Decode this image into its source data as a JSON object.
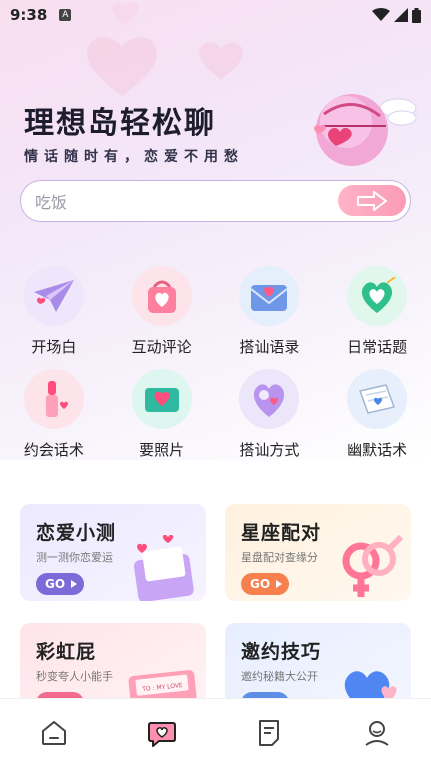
{
  "status_bar": {
    "time": "9:38",
    "badge": "A"
  },
  "header": {
    "title": "理想岛轻松聊",
    "subtitle": "情话随时有，恋爱不用愁"
  },
  "search": {
    "placeholder": "吃饭"
  },
  "categories": [
    {
      "label": "开场白",
      "icon": "paper-plane-icon",
      "bg": "#efe6fb"
    },
    {
      "label": "互动评论",
      "icon": "gift-bag-icon",
      "bg": "#fde4ea"
    },
    {
      "label": "搭讪语录",
      "icon": "envelope-icon",
      "bg": "#e4effb"
    },
    {
      "label": "日常话题",
      "icon": "heart-badge-icon",
      "bg": "#e1f7ee"
    },
    {
      "label": "约会话术",
      "icon": "lipstick-icon",
      "bg": "#fde4ea"
    },
    {
      "label": "要照片",
      "icon": "heart-letter-icon",
      "bg": "#def6f0"
    },
    {
      "label": "搭讪方式",
      "icon": "heart-balloon-icon",
      "bg": "#ece6fb"
    },
    {
      "label": "幽默话术",
      "icon": "scroll-icon",
      "bg": "#e6effb"
    }
  ],
  "cards": [
    {
      "title": "恋爱小测",
      "subtitle": "测一测你恋爱运",
      "go": "GO",
      "accent": "#7b6ad8"
    },
    {
      "title": "星座配对",
      "subtitle": "星盘配对查缘分",
      "go": "GO",
      "accent": "#f6804e"
    },
    {
      "title": "彩虹屁",
      "subtitle": "秒变夸人小能手",
      "go": "GO",
      "accent": "#f46b8e"
    },
    {
      "title": "邀约技巧",
      "subtitle": "邀约秘籍大公开",
      "go": "GO",
      "accent": "#5e8fe6"
    }
  ],
  "card_art": {
    "envelope_text": "TO : MY LOVE"
  },
  "tabbar": [
    "home-tab-icon",
    "chat-heart-tab-icon",
    "notes-tab-icon",
    "profile-tab-icon"
  ],
  "colors": {
    "brand_pink": "#fb9bb6",
    "search_border": "#c9b3e6"
  }
}
